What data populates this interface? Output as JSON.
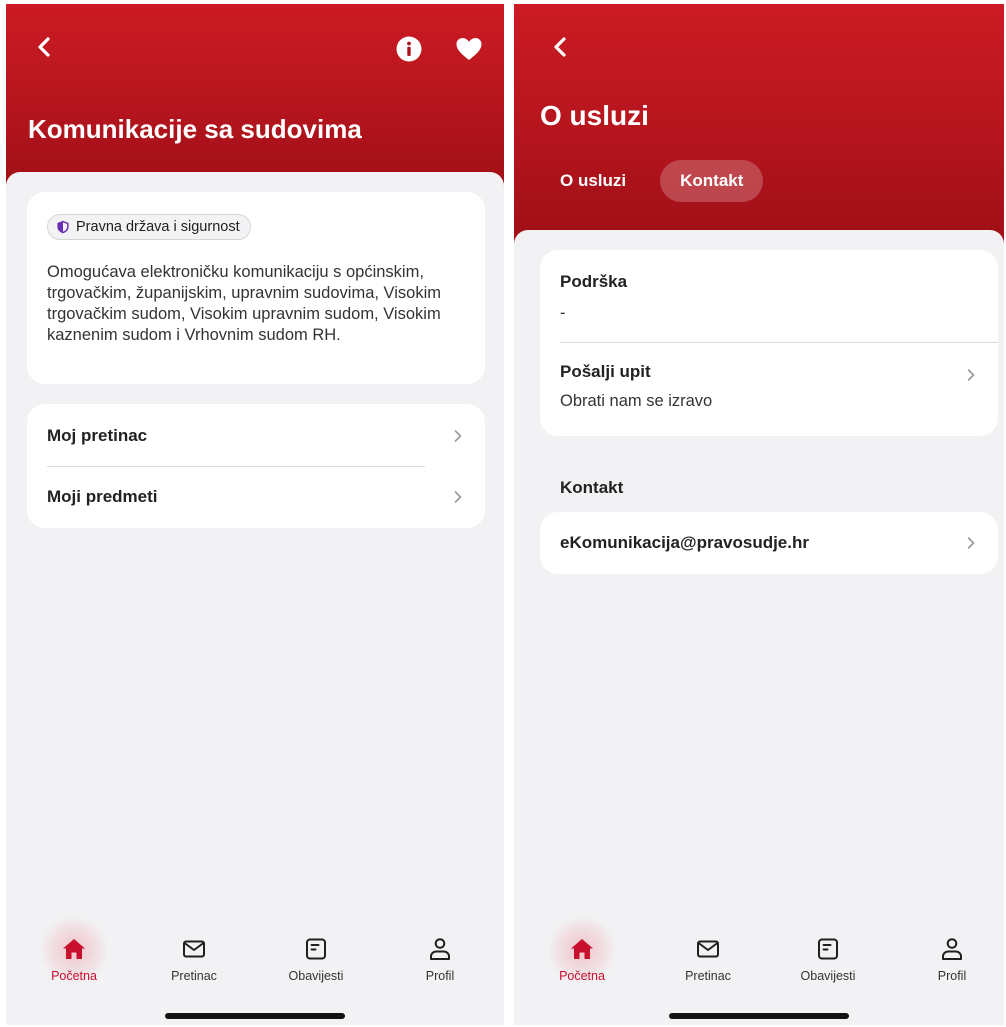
{
  "colors": {
    "brand_red": "#c8102e",
    "chip_shield": "#6b2fb3"
  },
  "left_screen": {
    "header": {
      "title": "Komunikacije sa sudovima",
      "icons": [
        "back-chevron-icon",
        "info-icon",
        "heart-icon"
      ]
    },
    "info_card": {
      "category_chip": "Pravna država i sigurnost",
      "description": "Omogućava elektroničku komunikaciju s općinskim, trgovačkim, županijskim, upravnim sudovima, Visokim trgovačkim sudom, Visokim upravnim sudom, Visokim kaznenim sudom i Vrhovnim sudom RH."
    },
    "links": [
      {
        "label": "Moj pretinac"
      },
      {
        "label": "Moji predmeti"
      }
    ]
  },
  "right_screen": {
    "header": {
      "title": "O usluzi"
    },
    "tabs": [
      {
        "label": "O usluzi",
        "active": false
      },
      {
        "label": "Kontakt",
        "active": true
      }
    ],
    "support_card": {
      "title": "Podrška",
      "value": "-",
      "query_title": "Pošalji upit",
      "query_subtitle": "Obrati nam se izravo"
    },
    "contact_section": {
      "label": "Kontakt",
      "email": "eKomunikacija@pravosudje.hr"
    }
  },
  "tabbar": [
    {
      "label": "Početna",
      "icon": "home-icon",
      "active": true
    },
    {
      "label": "Pretinac",
      "icon": "envelope-icon",
      "active": false
    },
    {
      "label": "Obavijesti",
      "icon": "notice-icon",
      "active": false
    },
    {
      "label": "Profil",
      "icon": "user-icon",
      "active": false
    }
  ]
}
